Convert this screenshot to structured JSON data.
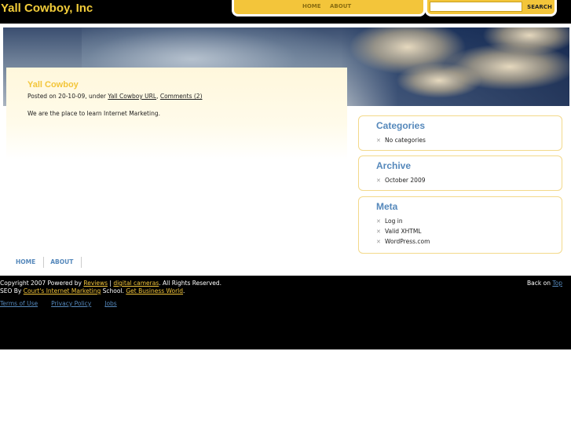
{
  "site": {
    "title": "Yall Cowboy, Inc"
  },
  "nav": {
    "items": [
      {
        "label": "HOME"
      },
      {
        "label": "ABOUT"
      }
    ]
  },
  "search": {
    "placeholder": "",
    "button_label": "SEARCH"
  },
  "post": {
    "title": "Yall Cowboy",
    "meta_prefix": "Posted on 20-10-09, under ",
    "category_link": "Yall Cowboy URL",
    "comments_link": "Comments (2)",
    "body": "We are the place to learn Internet Marketing."
  },
  "sidebar": {
    "categories": {
      "title": "Categories",
      "items": [
        "No categories"
      ]
    },
    "archive": {
      "title": "Archive",
      "items": [
        "October 2009"
      ]
    },
    "meta": {
      "title": "Meta",
      "items": [
        "Log in",
        "Valid XHTML",
        "WordPress.com"
      ]
    }
  },
  "bottom_nav": {
    "items": [
      {
        "label": "HOME"
      },
      {
        "label": "ABOUT"
      }
    ]
  },
  "footer": {
    "copyright_prefix": "Copyright 2007 Powered by ",
    "reviews_link": "Reviews",
    "separator": " | ",
    "cameras_link": "digital cameras",
    "copyright_suffix": ". All Rights Reserved.",
    "seo_prefix": "SEO By ",
    "seo_link": "Court's Internet Marketing",
    "seo_middle": " School. ",
    "business_link": "Get Business World",
    "seo_suffix": ".",
    "back_prefix": "Back on ",
    "back_link": "Top",
    "links": [
      "Terms of Use",
      "Privacy Policy",
      "Jobs"
    ]
  },
  "colors": {
    "accent": "#f3c53a",
    "link_blue": "#5588bb",
    "footer_bg": "#000000"
  }
}
